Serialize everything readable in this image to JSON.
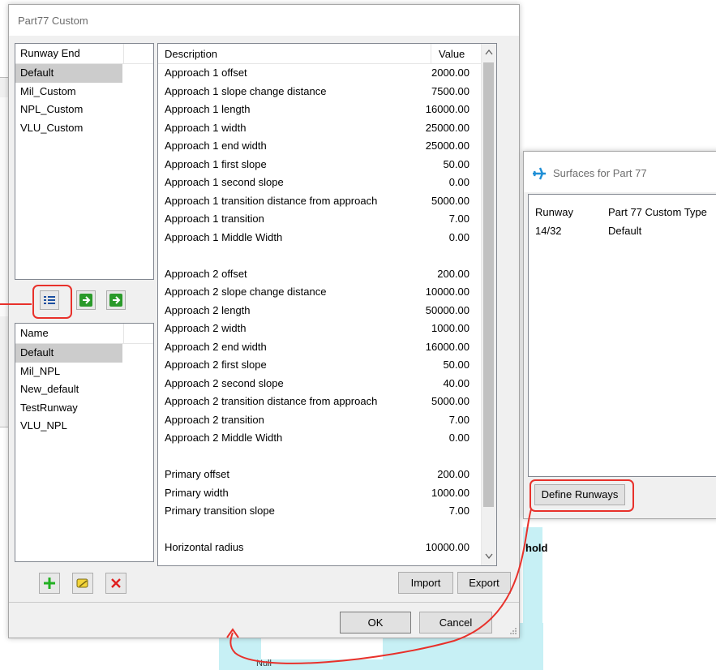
{
  "dialog": {
    "title": "Part77 Custom",
    "runway_end_header": "Runway End",
    "runway_end_items": [
      "Default",
      "Mil_Custom",
      "NPL_Custom",
      "VLU_Custom"
    ],
    "runway_end_selected": 0,
    "name_header": "Name",
    "name_items": [
      "Default",
      "Mil_NPL",
      "New_default",
      "TestRunway",
      "VLU_NPL"
    ],
    "name_selected": 0,
    "grid": {
      "col_description": "Description",
      "col_value": "Value",
      "rows": [
        {
          "d": "Approach 1 offset",
          "v": "2000.00"
        },
        {
          "d": "Approach 1 slope change distance",
          "v": "7500.00"
        },
        {
          "d": "Approach 1 length",
          "v": "16000.00"
        },
        {
          "d": "Approach 1 width",
          "v": "25000.00"
        },
        {
          "d": "Approach 1 end width",
          "v": "25000.00"
        },
        {
          "d": "Approach 1 first slope",
          "v": "50.00"
        },
        {
          "d": "Approach 1 second slope",
          "v": "0.00"
        },
        {
          "d": "Approach 1 transition distance from approach",
          "v": "5000.00"
        },
        {
          "d": "Approach 1 transition",
          "v": "7.00"
        },
        {
          "d": "Approach 1 Middle Width",
          "v": "0.00"
        },
        {
          "d": "",
          "v": ""
        },
        {
          "d": "Approach 2 offset",
          "v": "200.00"
        },
        {
          "d": "Approach 2 slope change distance",
          "v": "10000.00"
        },
        {
          "d": "Approach 2 length",
          "v": "50000.00"
        },
        {
          "d": "Approach 2 width",
          "v": "1000.00"
        },
        {
          "d": "Approach 2 end width",
          "v": "16000.00"
        },
        {
          "d": "Approach 2 first slope",
          "v": "50.00"
        },
        {
          "d": "Approach 2 second slope",
          "v": "40.00"
        },
        {
          "d": "Approach 2 transition distance from approach",
          "v": "5000.00"
        },
        {
          "d": "Approach 2 transition",
          "v": "7.00"
        },
        {
          "d": "Approach 2 Middle Width",
          "v": "0.00"
        },
        {
          "d": "",
          "v": ""
        },
        {
          "d": "Primary offset",
          "v": "200.00"
        },
        {
          "d": "Primary width",
          "v": "1000.00"
        },
        {
          "d": "Primary transition slope",
          "v": "7.00"
        },
        {
          "d": "",
          "v": ""
        },
        {
          "d": "Horizontal radius",
          "v": "10000.00"
        }
      ]
    },
    "buttons": {
      "import": "Import",
      "export": "Export",
      "ok": "OK",
      "cancel": "Cancel"
    },
    "icons": {
      "add": "plus-icon",
      "edit": "edit-icon",
      "delete": "delete-icon",
      "runway_list": "list-icon",
      "apply_green_1": "green-arrow-icon",
      "apply_green_2": "green-arrow-icon"
    }
  },
  "surfaces_window": {
    "title": "Surfaces for Part 77",
    "col_runway": "Runway",
    "col_type": "Part 77 Custom Type",
    "rows": [
      {
        "runway": "14/32",
        "type": "Default"
      }
    ],
    "define_button": "Define Runways"
  },
  "background": {
    "hold_text": "hold",
    "bottom_text": "Null"
  },
  "colors": {
    "annotation": "#e8312b",
    "selection": "#cccccc",
    "background_cyan": "#c7f0f5"
  }
}
